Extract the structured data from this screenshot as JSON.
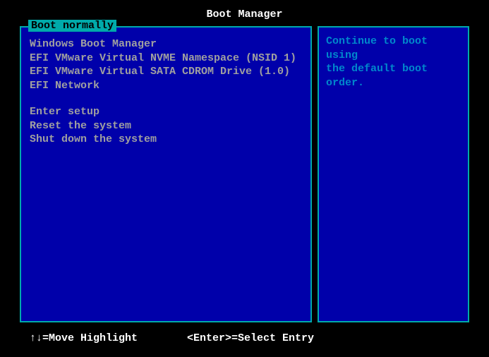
{
  "title": "Boot Manager",
  "left_panel": {
    "title": " Boot normally ",
    "boot_items": [
      "Windows Boot Manager",
      "EFI VMware Virtual NVME Namespace (NSID 1)",
      "EFI VMware Virtual SATA CDROM Drive (1.0)",
      "EFI Network"
    ],
    "action_items": [
      "Enter setup",
      "Reset the system",
      "Shut down the system"
    ]
  },
  "right_panel": {
    "help_line1": "Continue to boot using",
    "help_line2": "the default boot order."
  },
  "footer": {
    "hint1": "↑↓=Move Highlight",
    "hint2": "<Enter>=Select Entry"
  }
}
